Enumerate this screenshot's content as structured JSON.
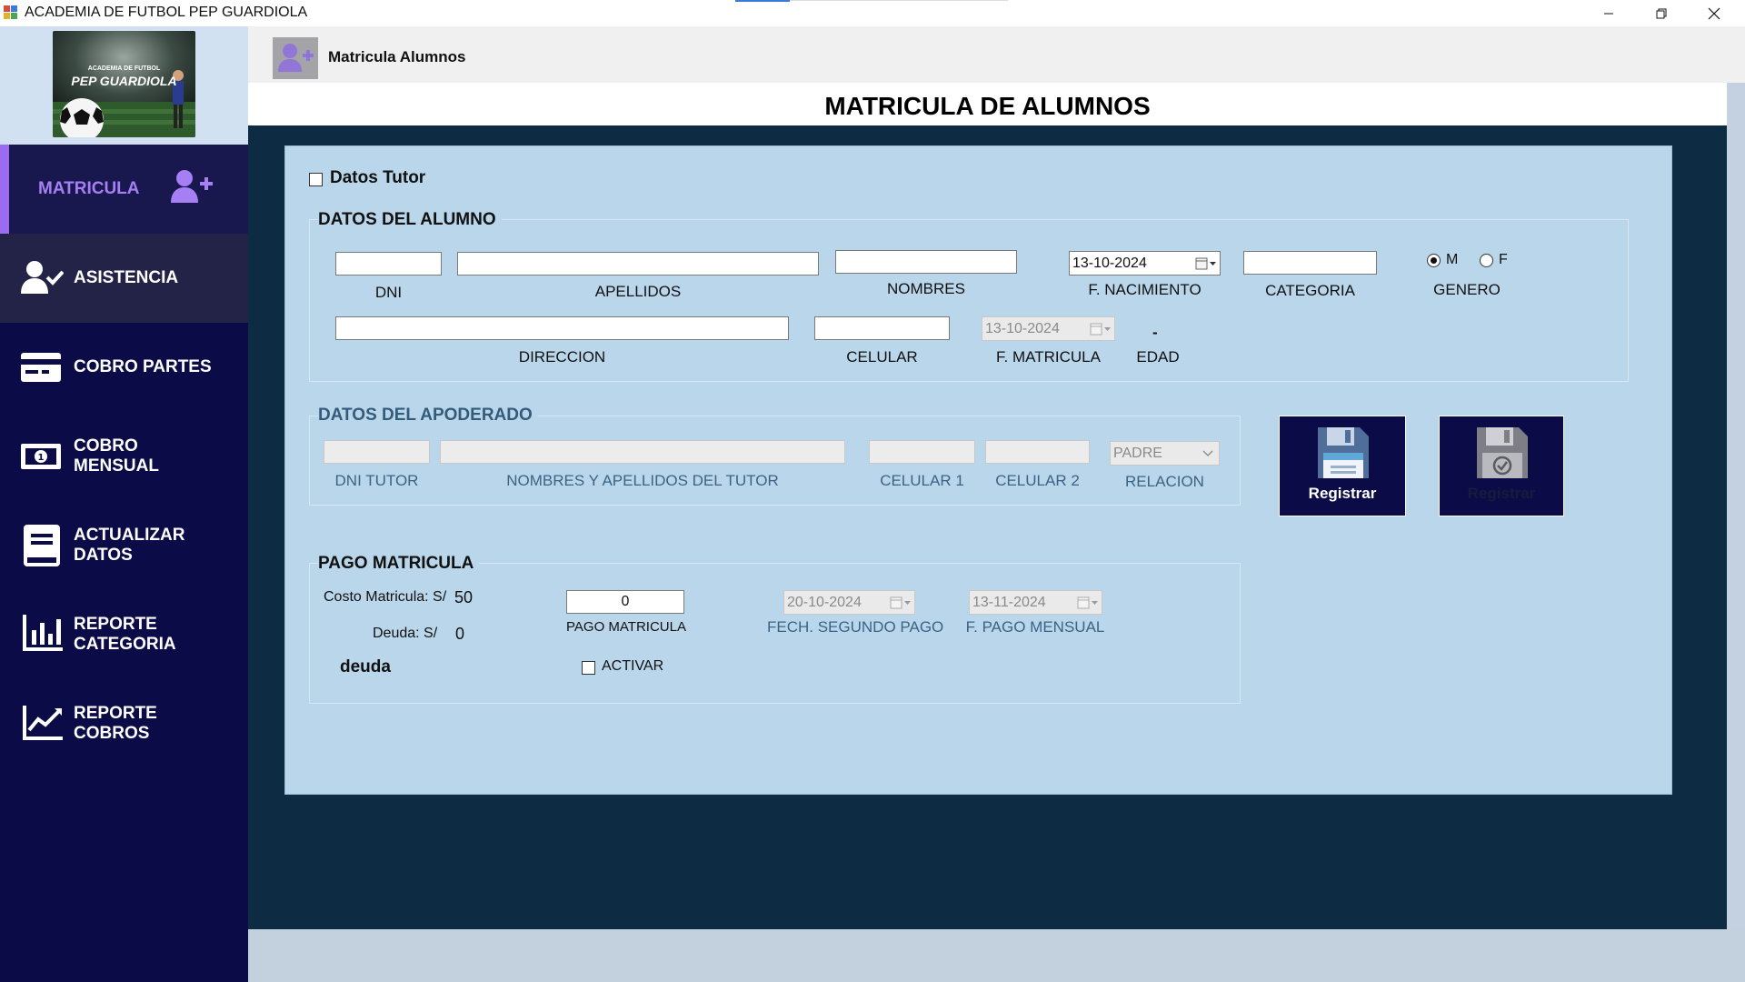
{
  "window": {
    "title": "ACADEMIA DE FUTBOL PEP GUARDIOLA",
    "minimize_icon": "minimize-icon",
    "maximize_icon": "restore-icon",
    "close_icon": "close-icon"
  },
  "logo": {
    "line1": "ACADEMIA DE FUTBOL",
    "line2": "PEP GUARDIOLA"
  },
  "sidebar": {
    "items": [
      {
        "label": "MATRICULA",
        "icon": "user-plus-icon",
        "active": true
      },
      {
        "label": "ASISTENCIA",
        "icon": "user-check-icon",
        "active": false
      },
      {
        "label": "COBRO PARTES",
        "icon": "card-icon",
        "active": false
      },
      {
        "label": "COBRO\nMENSUAL",
        "icon": "money-icon",
        "active": false
      },
      {
        "label": "ACTUALIZAR\nDATOS",
        "icon": "book-icon",
        "active": false
      },
      {
        "label": "REPORTE\nCATEGORIA",
        "icon": "bar-chart-icon",
        "active": false
      },
      {
        "label": "REPORTE\nCOBROS",
        "icon": "line-chart-icon",
        "active": false
      }
    ]
  },
  "header": {
    "title": "Matricula Alumnos",
    "icon": "user-plus-icon"
  },
  "page_title": "MATRICULA DE ALUMNOS",
  "tutor_checkbox": {
    "label": "Datos Tutor",
    "checked": false
  },
  "alumno": {
    "title": "DATOS DEL ALUMNO",
    "dni": {
      "label": "DNI",
      "value": ""
    },
    "apellidos": {
      "label": "APELLIDOS",
      "value": ""
    },
    "nombres": {
      "label": "NOMBRES",
      "value": ""
    },
    "f_nacimiento": {
      "label": "F. NACIMIENTO",
      "value": "13-10-2024"
    },
    "categoria": {
      "label": "CATEGORIA",
      "value": ""
    },
    "genero": {
      "label": "GENERO",
      "options": [
        "M",
        "F"
      ],
      "selected": "M"
    },
    "direccion": {
      "label": "DIRECCION",
      "value": ""
    },
    "celular": {
      "label": "CELULAR",
      "value": ""
    },
    "f_matricula": {
      "label": "F. MATRICULA",
      "value": "13-10-2024"
    },
    "edad": {
      "label": "EDAD",
      "value": "-"
    }
  },
  "apoderado": {
    "title": "DATOS DEL APODERADO",
    "dni_tutor": {
      "label": "DNI TUTOR",
      "value": ""
    },
    "nombres_tutor": {
      "label": "NOMBRES Y APELLIDOS DEL TUTOR",
      "value": ""
    },
    "celular1": {
      "label": "CELULAR 1",
      "value": ""
    },
    "celular2": {
      "label": "CELULAR 2",
      "value": ""
    },
    "relacion": {
      "label": "RELACION",
      "value": "PADRE"
    }
  },
  "buttons": {
    "registrar": "Registrar",
    "registrar2": "Registrar"
  },
  "pago": {
    "title": "PAGO MATRICULA",
    "costo_label": "Costo Matricula: S/",
    "costo_value": "50",
    "deuda_label": "Deuda: S/",
    "deuda_value": "0",
    "deuda_text": "deuda",
    "pago_matricula": {
      "label": "PAGO MATRICULA",
      "value": "0"
    },
    "activar": {
      "label": "ACTIVAR",
      "checked": false
    },
    "fech_segundo_pago": {
      "label": "FECH. SEGUNDO PAGO",
      "value": "20-10-2024"
    },
    "f_pago_mensual": {
      "label": "F. PAGO MENSUAL",
      "value": "13-11-2024"
    }
  },
  "colors": {
    "sidebar_bg": "#0b0b47",
    "active_item_bg": "#18184f",
    "active_accent": "#9b6cf0",
    "panel_bg": "#bad6eb",
    "main_bg": "#0d2b43"
  }
}
